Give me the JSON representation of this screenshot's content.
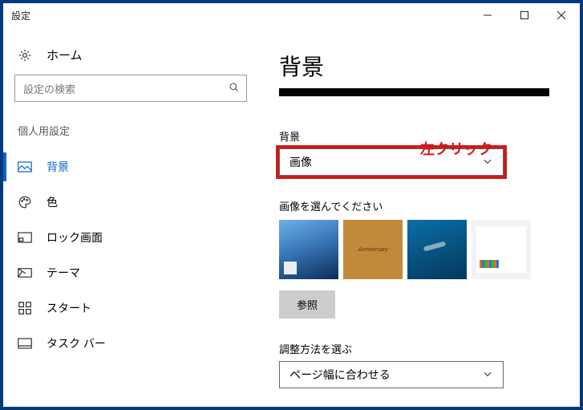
{
  "window": {
    "title": "設定"
  },
  "sidebar": {
    "home": "ホーム",
    "search_placeholder": "設定の検索",
    "section": "個人用設定",
    "items": [
      {
        "label": "背景"
      },
      {
        "label": "色"
      },
      {
        "label": "ロック画面"
      },
      {
        "label": "テーマ"
      },
      {
        "label": "スタート"
      },
      {
        "label": "タスク バー"
      }
    ]
  },
  "content": {
    "page_title": "背景",
    "bg_label": "背景",
    "bg_dropdown_value": "画像",
    "choose_label": "画像を選んでください",
    "browse": "参照",
    "fit_label": "調整方法を選ぶ",
    "fit_dropdown_value": "ページ幅に合わせる"
  },
  "annotation": {
    "text": "左クリック"
  }
}
